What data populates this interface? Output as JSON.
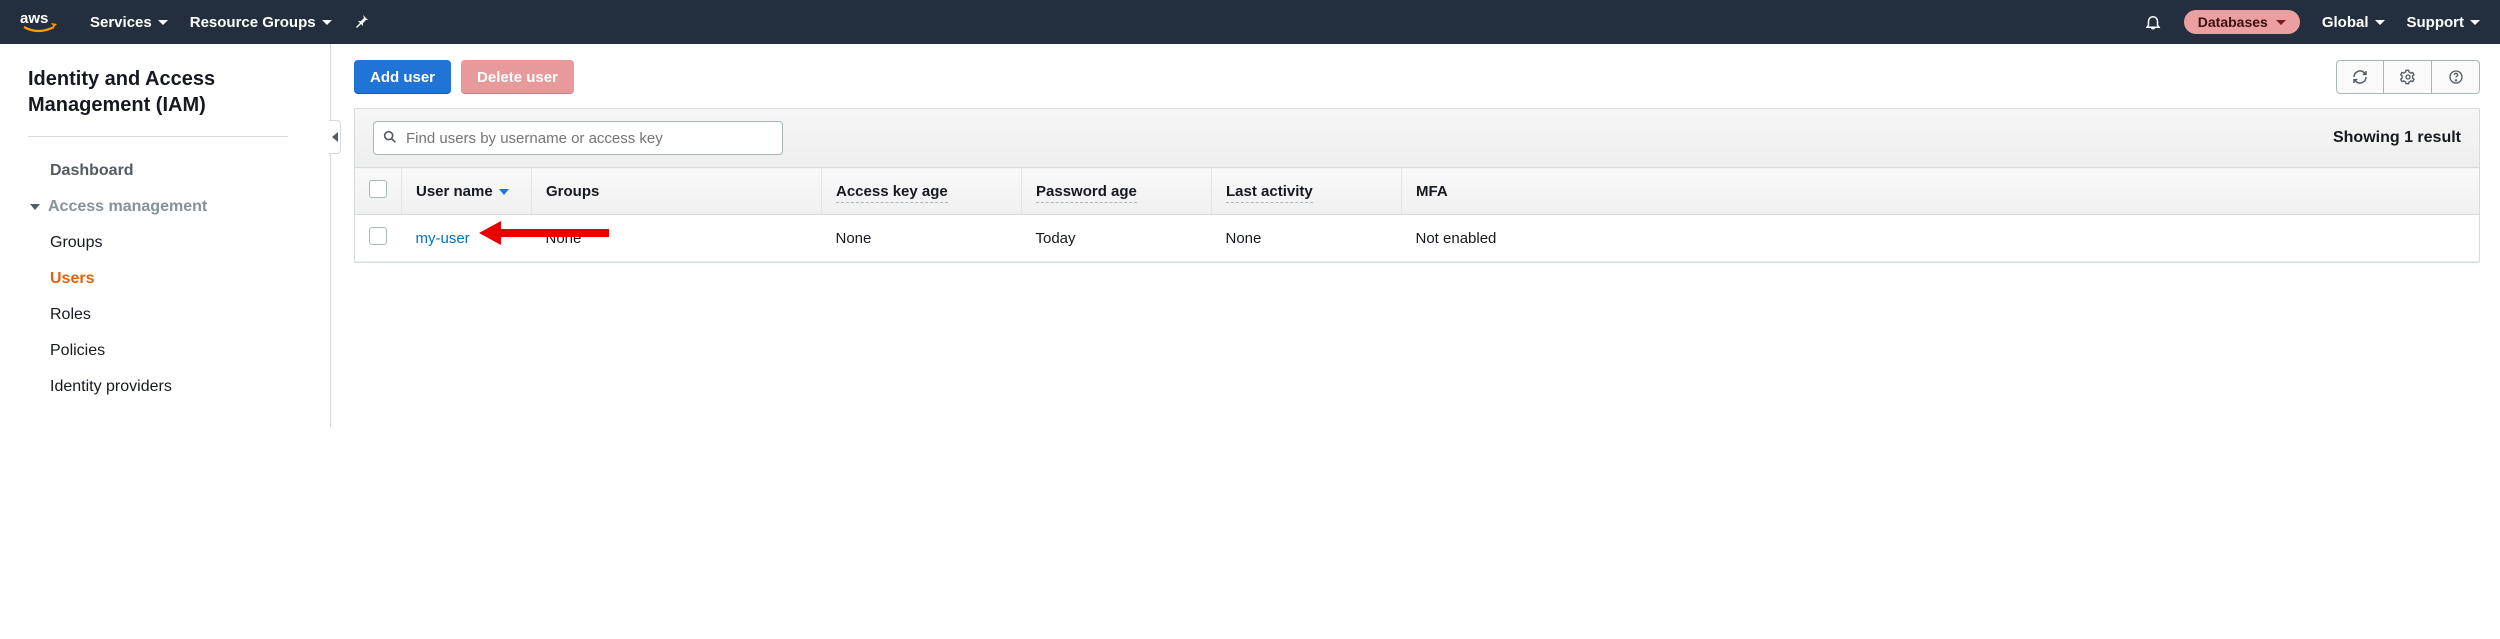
{
  "topnav": {
    "services": "Services",
    "resource_groups": "Resource Groups",
    "region": "Global",
    "support": "Support",
    "tag_pill": "Databases"
  },
  "sidebar": {
    "title": "Identity and Access Management (IAM)",
    "dashboard": "Dashboard",
    "access_mgmt": "Access management",
    "groups": "Groups",
    "users": "Users",
    "roles": "Roles",
    "policies": "Policies",
    "identity_providers": "Identity providers"
  },
  "toolbar": {
    "add_user": "Add user",
    "delete_user": "Delete user"
  },
  "panel": {
    "search_placeholder": "Find users by username or access key",
    "result_count": "Showing 1 result"
  },
  "table": {
    "headers": {
      "user_name": "User name",
      "groups": "Groups",
      "access_key_age": "Access key age",
      "password_age": "Password age",
      "last_activity": "Last activity",
      "mfa": "MFA"
    },
    "rows": [
      {
        "user_name": "my-user",
        "groups": "None",
        "access_key_age": "None",
        "password_age": "Today",
        "last_activity": "None",
        "mfa": "Not enabled"
      }
    ]
  }
}
